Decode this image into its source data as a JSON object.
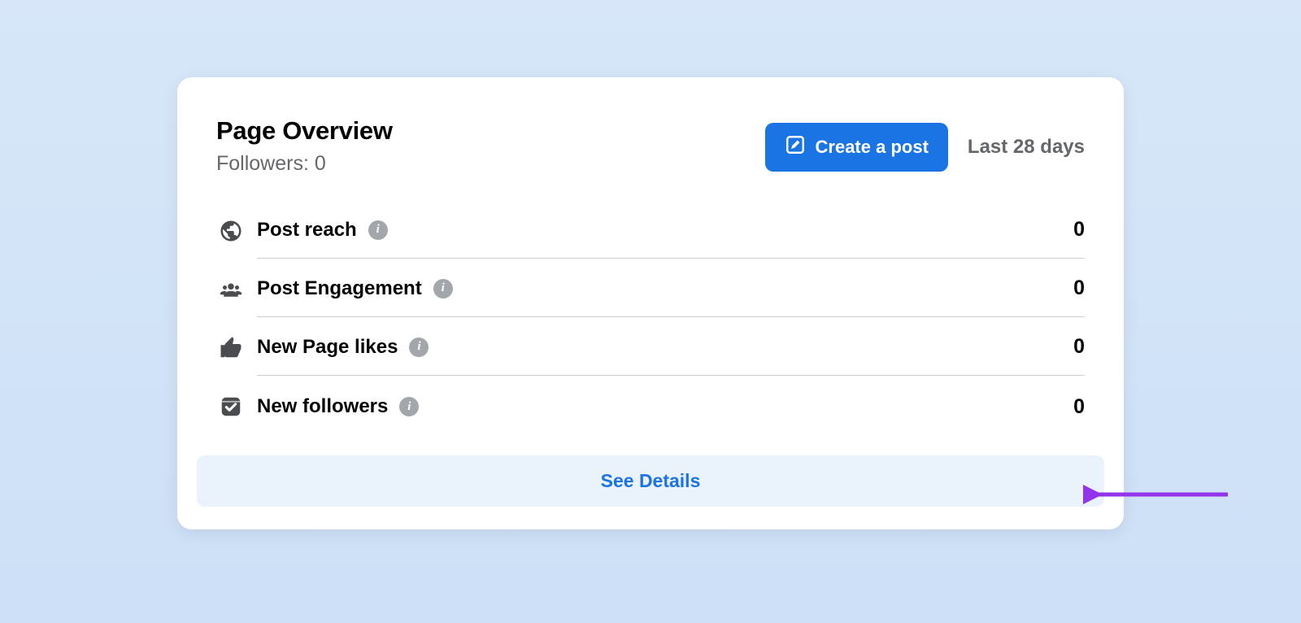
{
  "card": {
    "title": "Page Overview",
    "subtitle": "Followers: 0",
    "create_post_label": "Create a post",
    "timeframe": "Last 28 days",
    "see_details_label": "See Details"
  },
  "metrics": [
    {
      "icon": "globe-icon",
      "label": "Post reach",
      "value": "0"
    },
    {
      "icon": "people-icon",
      "label": "Post Engagement",
      "value": "0"
    },
    {
      "icon": "thumbs-up-icon",
      "label": "New Page likes",
      "value": "0"
    },
    {
      "icon": "followers-icon",
      "label": "New followers",
      "value": "0"
    }
  ],
  "annotation": {
    "arrow_color": "#9333ea"
  }
}
